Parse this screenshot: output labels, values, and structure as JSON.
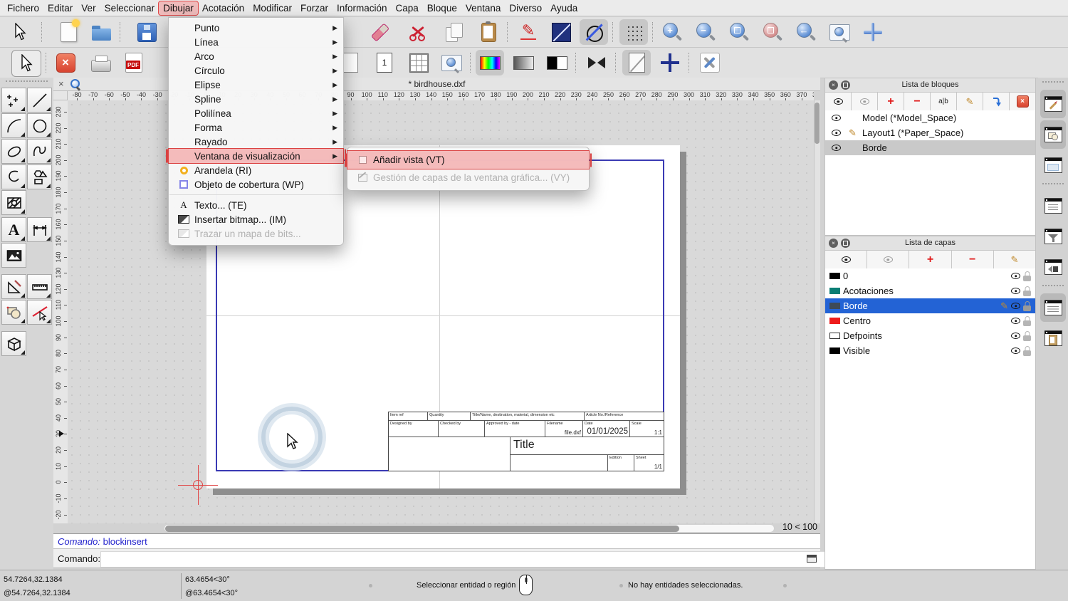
{
  "window": {
    "tab_title": "* birdhouse.dxf",
    "zoom_indicator": "10 < 100"
  },
  "menu_bar": {
    "items": [
      "Fichero",
      "Editar",
      "Ver",
      "Seleccionar",
      "Dibujar",
      "Acotación",
      "Modificar",
      "Forzar",
      "Información",
      "Capa",
      "Bloque",
      "Ventana",
      "Diverso",
      "Ayuda"
    ],
    "annotated": "Dibujar"
  },
  "draw_menu": {
    "items": [
      {
        "label": "Punto",
        "submenu": true
      },
      {
        "label": "Línea",
        "submenu": true
      },
      {
        "label": "Arco",
        "submenu": true
      },
      {
        "label": "Círculo",
        "submenu": true
      },
      {
        "label": "Elipse",
        "submenu": true
      },
      {
        "label": "Spline",
        "submenu": true
      },
      {
        "label": "Polilínea",
        "submenu": true
      },
      {
        "label": "Forma",
        "submenu": true
      },
      {
        "label": "Rayado",
        "submenu": true
      },
      {
        "label": "Ventana de visualización",
        "submenu": true,
        "highlighted": true
      },
      {
        "label": "Arandela (RI)",
        "icon": "washer-icon"
      },
      {
        "label": "Objeto de cobertura (WP)",
        "icon": "wipeout-icon"
      },
      {
        "separator": true
      },
      {
        "label": "Texto... (TE)",
        "icon": "text-icon",
        "glyph": "A"
      },
      {
        "label": "Insertar bitmap... (IM)",
        "icon": "bitmap-icon"
      },
      {
        "label": "Trazar un mapa de bits...",
        "icon": "trace-icon",
        "disabled": true
      }
    ]
  },
  "viewport_submenu": {
    "items": [
      {
        "label": "Añadir vista (VT)",
        "icon": "viewport-icon",
        "highlighted": true
      },
      {
        "label": "Gestión de capas de la ventana gráfica... (VY)",
        "icon": "viewport-layers-icon",
        "disabled": true
      }
    ]
  },
  "rulers": {
    "horizontal": {
      "start": -80,
      "end": 380,
      "step": 10
    },
    "vertical": {
      "start": 230,
      "end": -20,
      "step": 10,
      "marker_value": 30
    }
  },
  "sheet": {
    "title_block": {
      "item_ref": "Item ref",
      "quantity": "Quantity",
      "title_name": "Title/Name, destination, material, dimension etc",
      "article": "Article No./Reference",
      "designed_by": "Designed by",
      "checked_by": "Checked by",
      "approved_by": "Approved by - date",
      "filename_label": "Filename",
      "filename": "file.dxf",
      "date_label": "Date",
      "date": "01/01/2025",
      "scale_label": "Scale",
      "scale": "1:1",
      "title": "Title",
      "edition_label": "Edition",
      "sheet_label": "Sheet",
      "sheet": "1/1"
    }
  },
  "panels": {
    "blocks": {
      "title": "Lista de bloques",
      "rename_glyph": "a|b",
      "toolbar_icons": [
        "show-all-blocks",
        "hide-all-blocks",
        "add-block",
        "remove-block",
        "rename-block",
        "edit-block",
        "insert-block",
        "delete-block"
      ],
      "rows": [
        {
          "name": "Model (*Model_Space)",
          "icons": [
            "eye"
          ]
        },
        {
          "name": "Layout1 (*Paper_Space)",
          "icons": [
            "eye",
            "pencil"
          ]
        },
        {
          "name": "Borde",
          "icons": [
            "eye"
          ],
          "selected": true
        }
      ]
    },
    "layers": {
      "title": "Lista de capas",
      "toolbar_icons": [
        "show-all-layers",
        "hide-all-layers",
        "add-layer",
        "remove-layer",
        "edit-layer"
      ],
      "rows": [
        {
          "name": "0",
          "color": "#000000"
        },
        {
          "name": "Acotaciones",
          "color": "#0b7e75"
        },
        {
          "name": "Borde",
          "color": "#3e4a57",
          "selected": true,
          "editing": true
        },
        {
          "name": "Centro",
          "color": "#ee1c1c"
        },
        {
          "name": "Defpoints",
          "color": "#ffffff"
        },
        {
          "name": "Visible",
          "color": "#000000"
        }
      ]
    }
  },
  "console": {
    "history_prompt": "Comando:",
    "history_entry": "blockinsert",
    "input_prompt": "Comando:",
    "input_value": ""
  },
  "status_bar": {
    "abs_cartesian": "54.7264,32.1384",
    "rel_cartesian": "@54.7264,32.1384",
    "abs_polar": "63.4654<30°",
    "rel_polar": "@63.4654<30°",
    "mouse_hint": "Seleccionar entidad o región",
    "selection_status": "No hay entidades seleccionadas."
  },
  "toolbar_icons": {
    "row1": [
      "select-cursor",
      "new-document",
      "open-document",
      "save-document",
      "eraser",
      "cut",
      "copy",
      "paste",
      "draw-pencil",
      "edit-box",
      "circle-line",
      "grid-toggle",
      "zoom-in",
      "zoom-out",
      "zoom-auto",
      "zoom-selection",
      "zoom-previous",
      "zoom-window",
      "zoom-pan"
    ],
    "row2": [
      "select-cursor",
      "close-drawing",
      "print",
      "export-pdf",
      "page-blank",
      "single-page",
      "page-grid",
      "zoom-page",
      "color-view",
      "grayscale-view",
      "blackwhite-view",
      "draft-bowtie",
      "draft-mode",
      "crosshair-plus",
      "tool-options"
    ],
    "left_palette": [
      "points",
      "line",
      "arc",
      "circle",
      "ellipse",
      "spline",
      "polyline",
      "shapes",
      "hatch",
      "text",
      "dimension",
      "image",
      "draft-tools",
      "measure",
      "shape-overlap",
      "modify-line",
      "box-3d"
    ],
    "dock": [
      "pen-window",
      "shapes-window",
      "blank-window",
      "list-window",
      "filter-window",
      "projection-window",
      "command-window",
      "clipboard-window"
    ]
  },
  "colors": {
    "annotation_border": "#db4343",
    "annotation_fill": "rgba(243,139,139,0.55)",
    "layer_selected_bg": "#2363d5",
    "sheet_border_blue": "#3a3ab4"
  }
}
